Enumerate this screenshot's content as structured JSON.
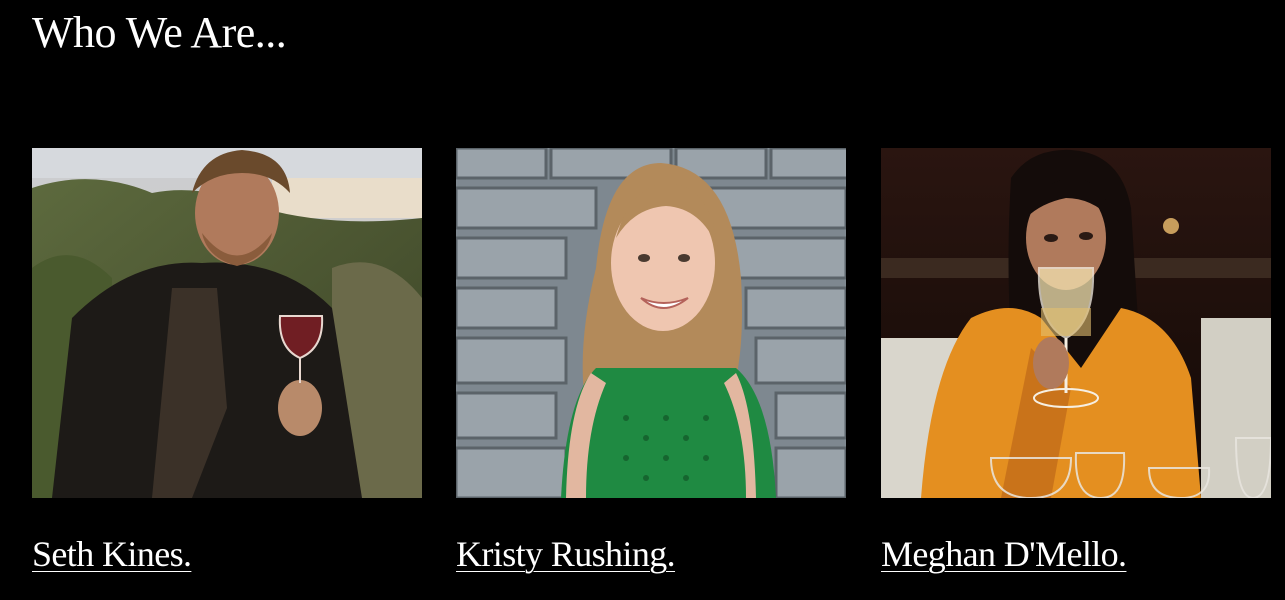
{
  "section": {
    "heading": "Who We Are..."
  },
  "team": [
    {
      "name": "Seth Kines.",
      "photo_desc": "man in dark blazer holding red wine glass at beach"
    },
    {
      "name": "Kristy Rushing.",
      "photo_desc": "smiling woman in green top in front of stone steps"
    },
    {
      "name": "Meghan D'Mello.",
      "photo_desc": "woman in orange shawl smelling white wine"
    }
  ],
  "colors": {
    "background": "#000000",
    "text": "#ffffff"
  }
}
